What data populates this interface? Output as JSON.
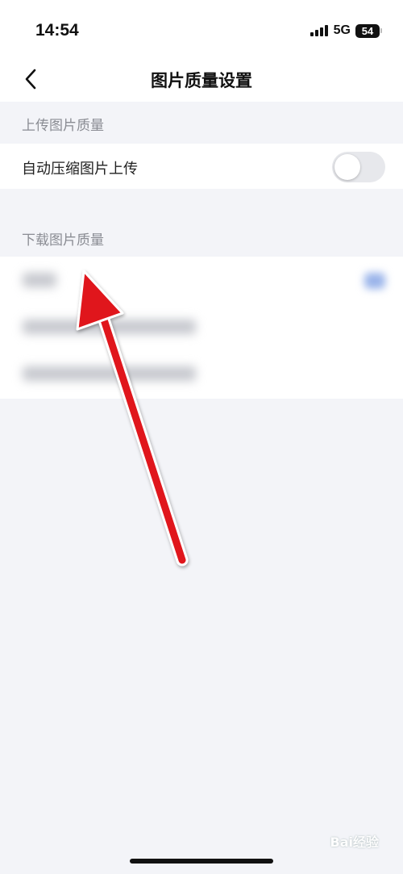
{
  "status_bar": {
    "time": "14:54",
    "network": "5G",
    "battery": "54"
  },
  "nav": {
    "title": "图片质量设置",
    "back_icon": "chevron-left-icon"
  },
  "upload_section": {
    "header": "上传图片质量",
    "auto_compress": {
      "label": "自动压缩图片上传",
      "enabled": false
    }
  },
  "download_section": {
    "header": "下载图片质量"
  },
  "annotation": {
    "arrow_color": "#e0121b"
  },
  "watermark": "Bai经验"
}
